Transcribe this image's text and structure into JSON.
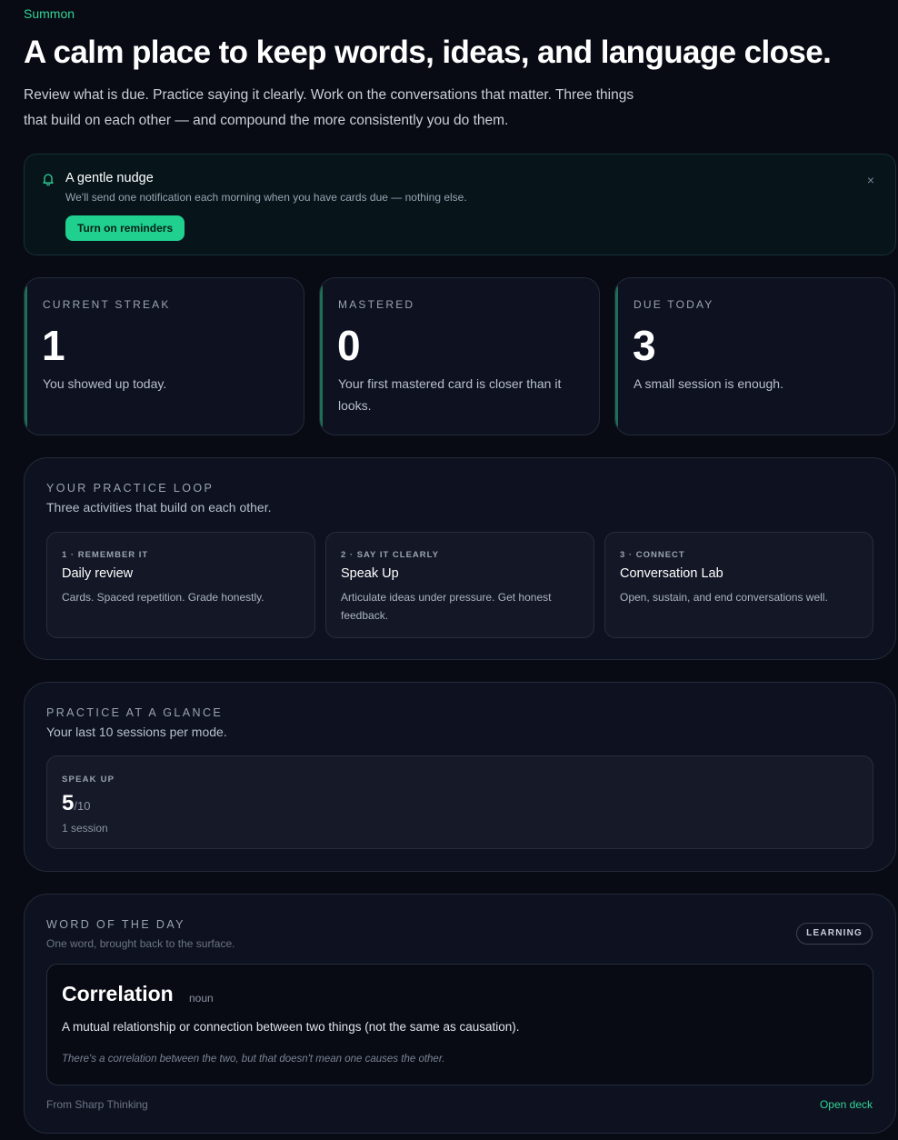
{
  "brand": "Summon",
  "hero": {
    "title": "A calm place to keep words, ideas, and language close.",
    "subtitle": "Review what is due. Practice saying it clearly. Work on the conversations that matter. Three things that build on each other — and compound the more consistently you do them."
  },
  "nudge": {
    "title": "A gentle nudge",
    "description": "We'll send one notification each morning when you have cards due — nothing else.",
    "button_label": "Turn on reminders",
    "close_glyph": "×",
    "icon": "bell-icon"
  },
  "stats": [
    {
      "label": "CURRENT STREAK",
      "value": "1",
      "note": "You showed up today."
    },
    {
      "label": "MASTERED",
      "value": "0",
      "note": "Your first mastered card is closer than it looks."
    },
    {
      "label": "DUE TODAY",
      "value": "3",
      "note": "A small session is enough."
    }
  ],
  "loop": {
    "label": "YOUR PRACTICE LOOP",
    "subtitle": "Three activities that build on each other.",
    "items": [
      {
        "step": "1 · REMEMBER IT",
        "title": "Daily review",
        "description": "Cards. Spaced repetition. Grade honestly."
      },
      {
        "step": "2 · SAY IT CLEARLY",
        "title": "Speak Up",
        "description": "Articulate ideas under pressure. Get honest feedback."
      },
      {
        "step": "3 · CONNECT",
        "title": "Conversation Lab",
        "description": "Open, sustain, and end conversations well."
      }
    ]
  },
  "glance": {
    "label": "PRACTICE AT A GLANCE",
    "subtitle": "Your last 10 sessions per mode.",
    "mode": "SPEAK UP",
    "score": "5",
    "score_total": "/10",
    "sessions": "1 session"
  },
  "word": {
    "label": "WORD OF THE DAY",
    "subtitle": "One word, brought back to the surface.",
    "badge": "LEARNING",
    "term": "Correlation",
    "part_of_speech": "noun",
    "definition": "A mutual relationship or connection between two things (not the same as causation).",
    "example": "There's a correlation between the two, but that doesn't mean one causes the other.",
    "source": "From Sharp Thinking",
    "open_label": "Open deck"
  },
  "colors": {
    "accent": "#2fd596",
    "button": "#1fd08f",
    "background": "#080b14",
    "card": "#0e1220"
  }
}
